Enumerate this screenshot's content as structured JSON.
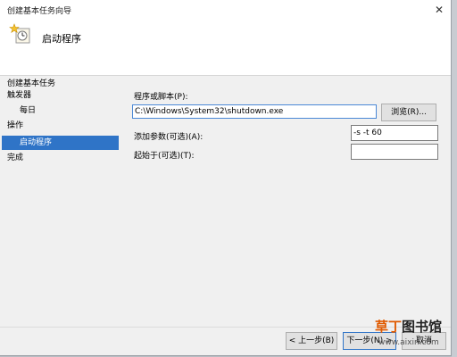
{
  "window": {
    "title": "创建基本任务向导",
    "close_glyph": "✕"
  },
  "header": {
    "title": "启动程序",
    "icon": "task-wizard-icon"
  },
  "sidebar": {
    "items": [
      {
        "label": "创建基本任务",
        "selected": false
      },
      {
        "label": "触发器",
        "selected": false
      },
      {
        "label": "每日",
        "selected": false
      },
      {
        "label": "操作",
        "selected": false
      },
      {
        "label": "启动程序",
        "selected": true
      },
      {
        "label": "完成",
        "selected": false
      }
    ]
  },
  "form": {
    "program_label": "程序或脚本(P):",
    "program_value": "C:\\Windows\\System32\\shutdown.exe",
    "browse_label": "浏览(R)...",
    "args_label": "添加参数(可选)(A):",
    "args_value": "-s -t 60",
    "start_in_label": "起始于(可选)(T):",
    "start_in_value": ""
  },
  "footer": {
    "back_label": "< 上一步(B)",
    "next_label": "下一步(N) >",
    "cancel_label": "取消"
  },
  "watermark": {
    "brand_a": "草丁",
    "brand_b": "图书馆",
    "url": "www.aixin.com"
  },
  "colors": {
    "selection": "#2f74c7",
    "focus_border": "#4a88d6",
    "dialog_bg": "#f0f0f0"
  }
}
